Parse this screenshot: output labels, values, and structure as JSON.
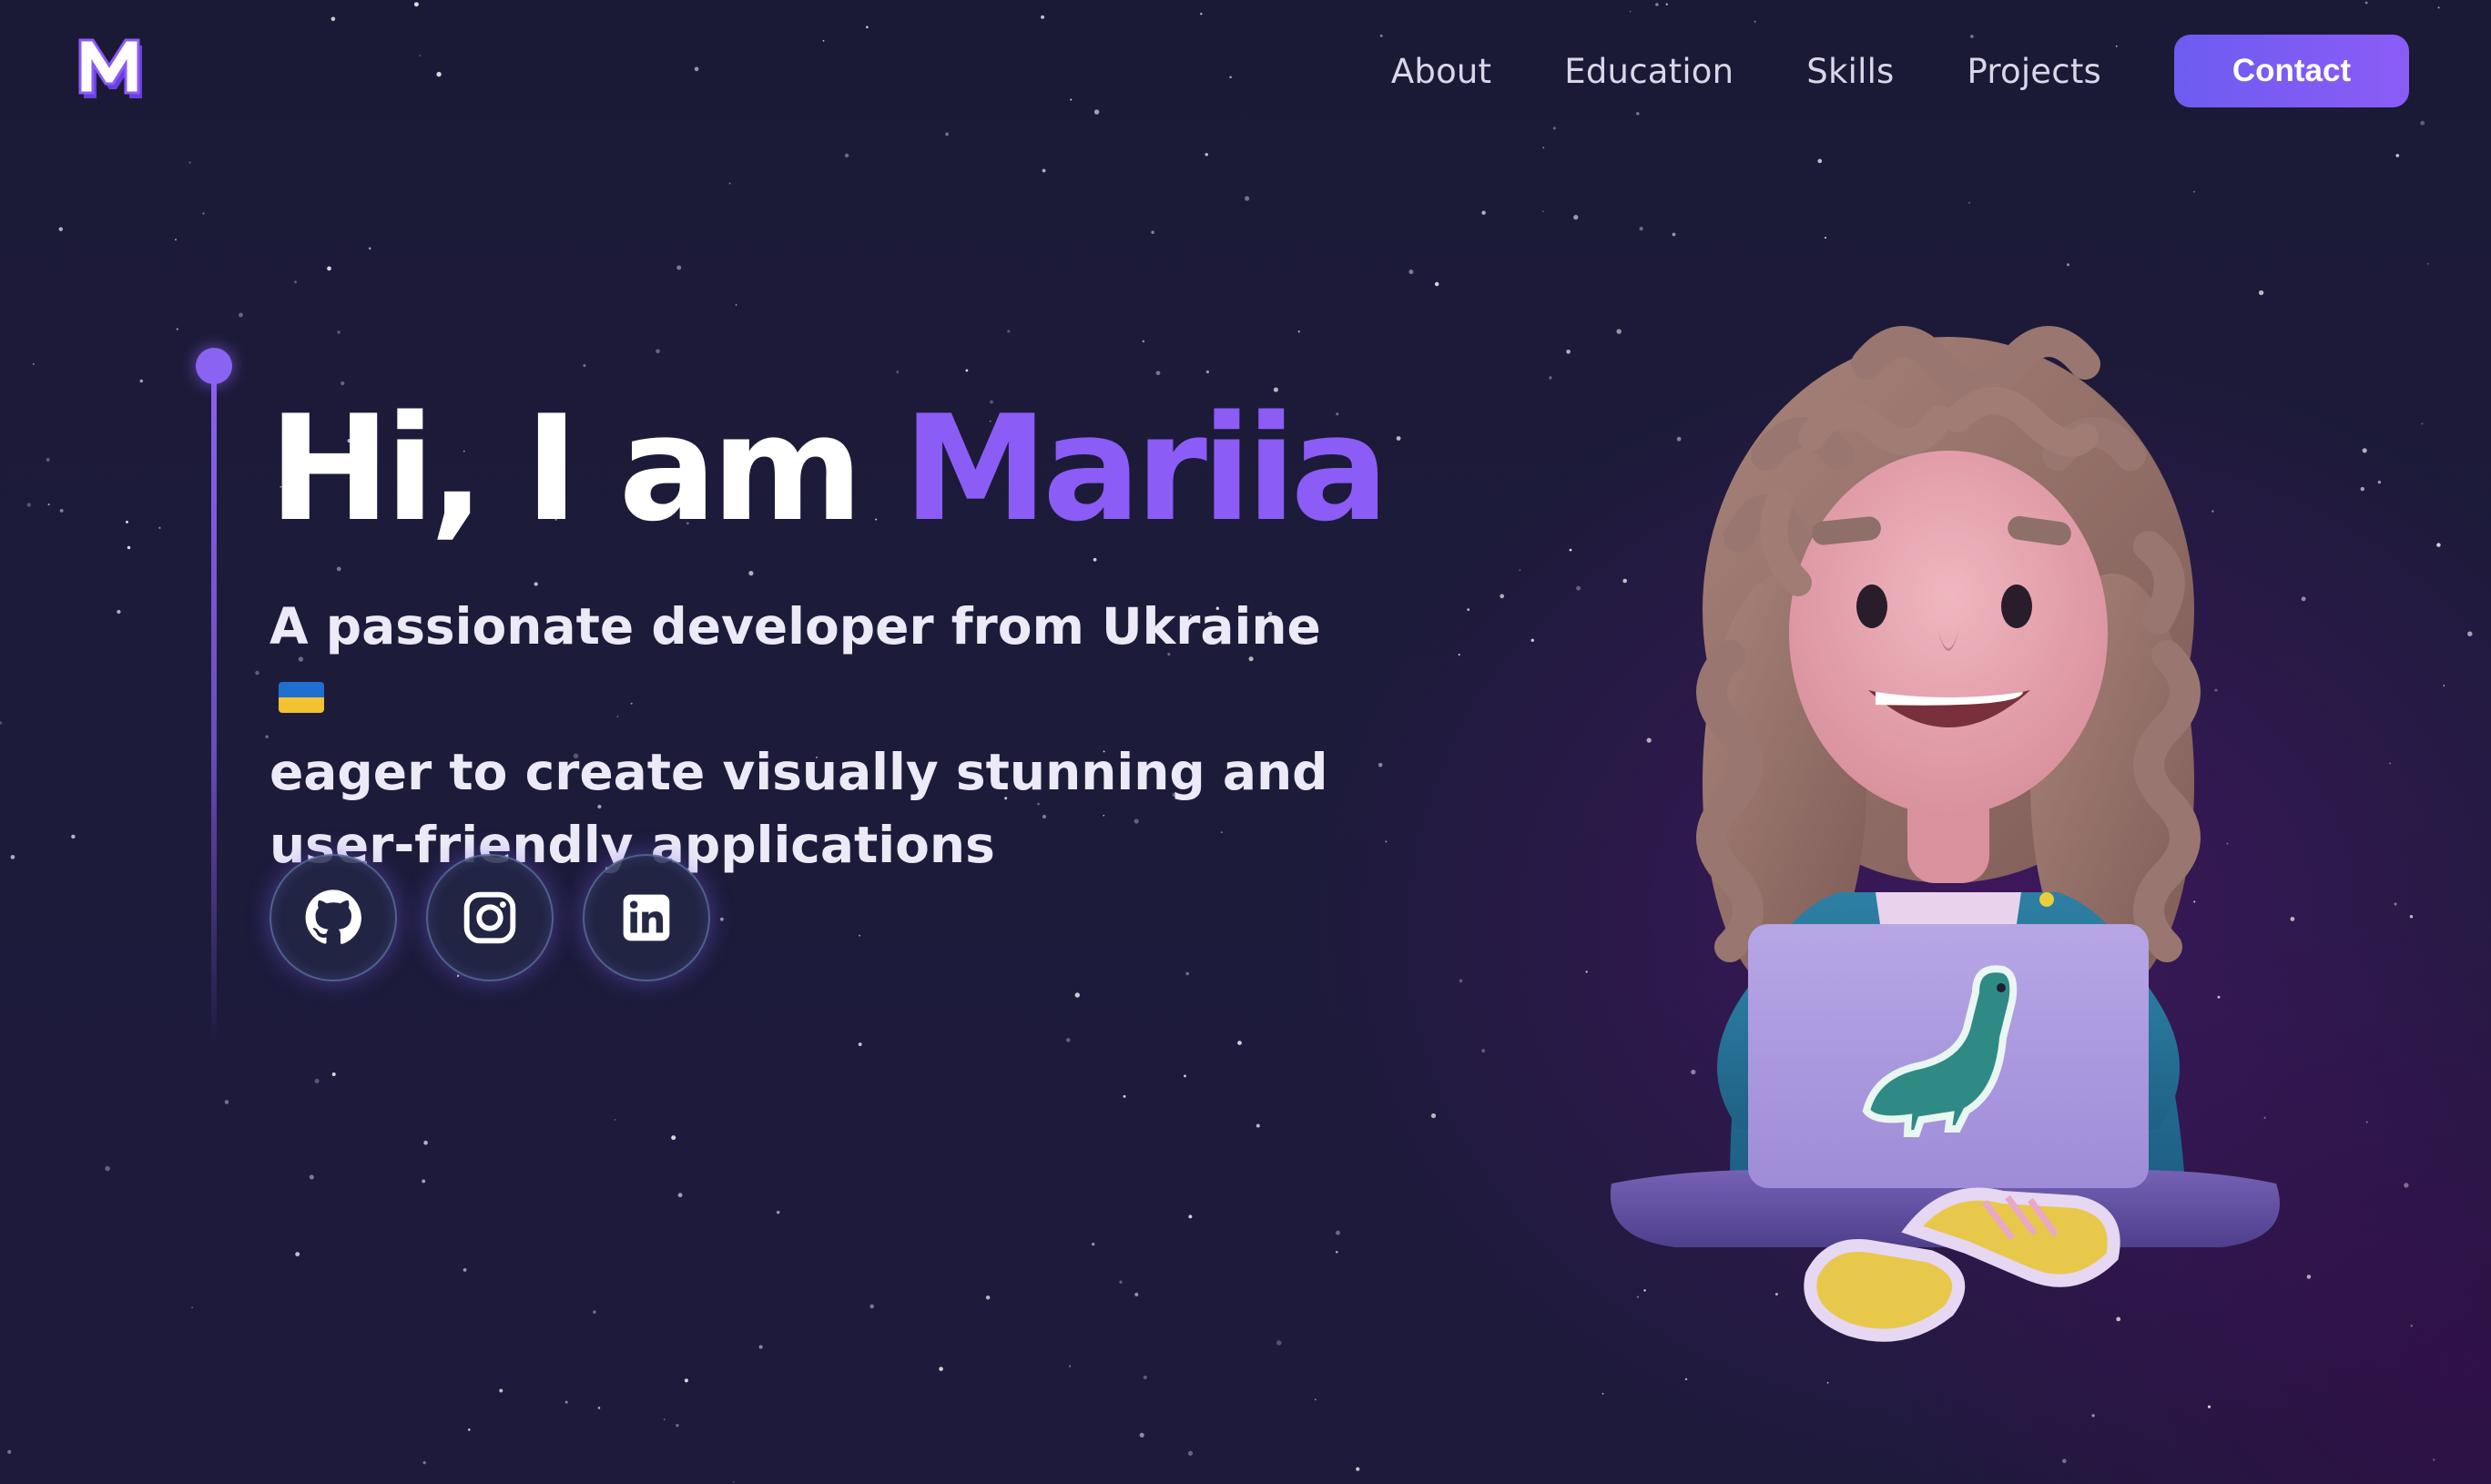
{
  "header": {
    "logo_icon": "m-logo-icon",
    "nav": [
      {
        "label": "About"
      },
      {
        "label": "Education"
      },
      {
        "label": "Skills"
      },
      {
        "label": "Projects"
      }
    ],
    "contact_label": "Contact"
  },
  "hero": {
    "greeting": "Hi, I am",
    "name": "Mariia",
    "subtitle_line1": "A passionate developer from Ukraine",
    "subtitle_line2": "eager to create visually stunning and",
    "subtitle_line3": "user-friendly applications",
    "flag_icon": "ukraine-flag-icon",
    "socials": [
      {
        "icon": "github-icon"
      },
      {
        "icon": "instagram-icon"
      },
      {
        "icon": "linkedin-icon"
      }
    ],
    "avatar": "3d-avatar-girl-with-laptop"
  },
  "colors": {
    "accent": "#8b5cf6",
    "background": "#1c1b3a",
    "contact_button": "#6d5cf0"
  }
}
